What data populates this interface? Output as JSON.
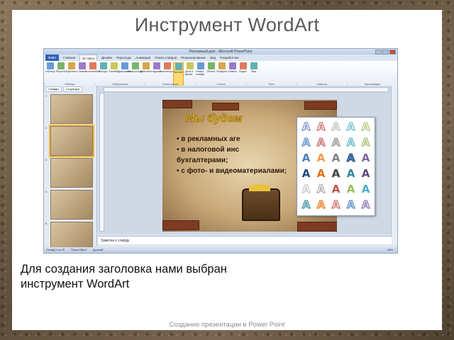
{
  "slide": {
    "title": "Инструмент WordArt",
    "caption_line1": "Для создания заголовка нами выбран",
    "caption_line2": "инструмент WordArt",
    "footer": "Создание презентации в Power Point"
  },
  "app": {
    "window_title": "Рекламный.pptx - Microsoft PowerPoint",
    "tabs": [
      "Файл",
      "Главная",
      "Вставка",
      "Дизайн",
      "Переходы",
      "Анимация",
      "Показ слайдов",
      "Рецензирование",
      "Вид",
      "Разработчик"
    ],
    "active_tab": "Вставка",
    "ribbon_buttons": [
      "Таблица",
      "Рисунок",
      "Картинка",
      "Снимок",
      "Фотоальбом",
      "Фигуры",
      "SmartArt",
      "Диаграмма",
      "Гиперссылка",
      "Действие",
      "Надпись",
      "Колонтитулы",
      "WordArt",
      "Дата и время",
      "Номер слайда",
      "Объект",
      "Формула",
      "Символ",
      "Видео",
      "Звук"
    ],
    "group_labels": [
      "Таблицы",
      "Изображения",
      "Иллюстрации",
      "Ссылки",
      "Текст",
      "Символы",
      "Мультимедиа"
    ],
    "left_panel_tabs": [
      "Слайды",
      "Структура"
    ],
    "thumbnail_numbers": [
      "1",
      "2",
      "3",
      "4",
      "5"
    ],
    "inner_slide": {
      "heading": "Мы будем",
      "bullets": [
        "• в рекламных аге",
        "• в налоговой инс",
        "бухгалтерами;",
        "• с фото- и видеоматериалами;"
      ]
    },
    "wordart_glyph": "A",
    "notes_placeholder": "Заметки к слайду",
    "status": {
      "slide_info": "Слайд 2 из 25",
      "theme": "\"Тема Office\"",
      "language": "русский",
      "zoom": "48%"
    }
  },
  "colors": {
    "frame": "#6b5a44",
    "ribbon_file_tab": "#2d62b5",
    "wordart_highlight": "#ffd970",
    "heading_gold": "#e8c21d"
  }
}
